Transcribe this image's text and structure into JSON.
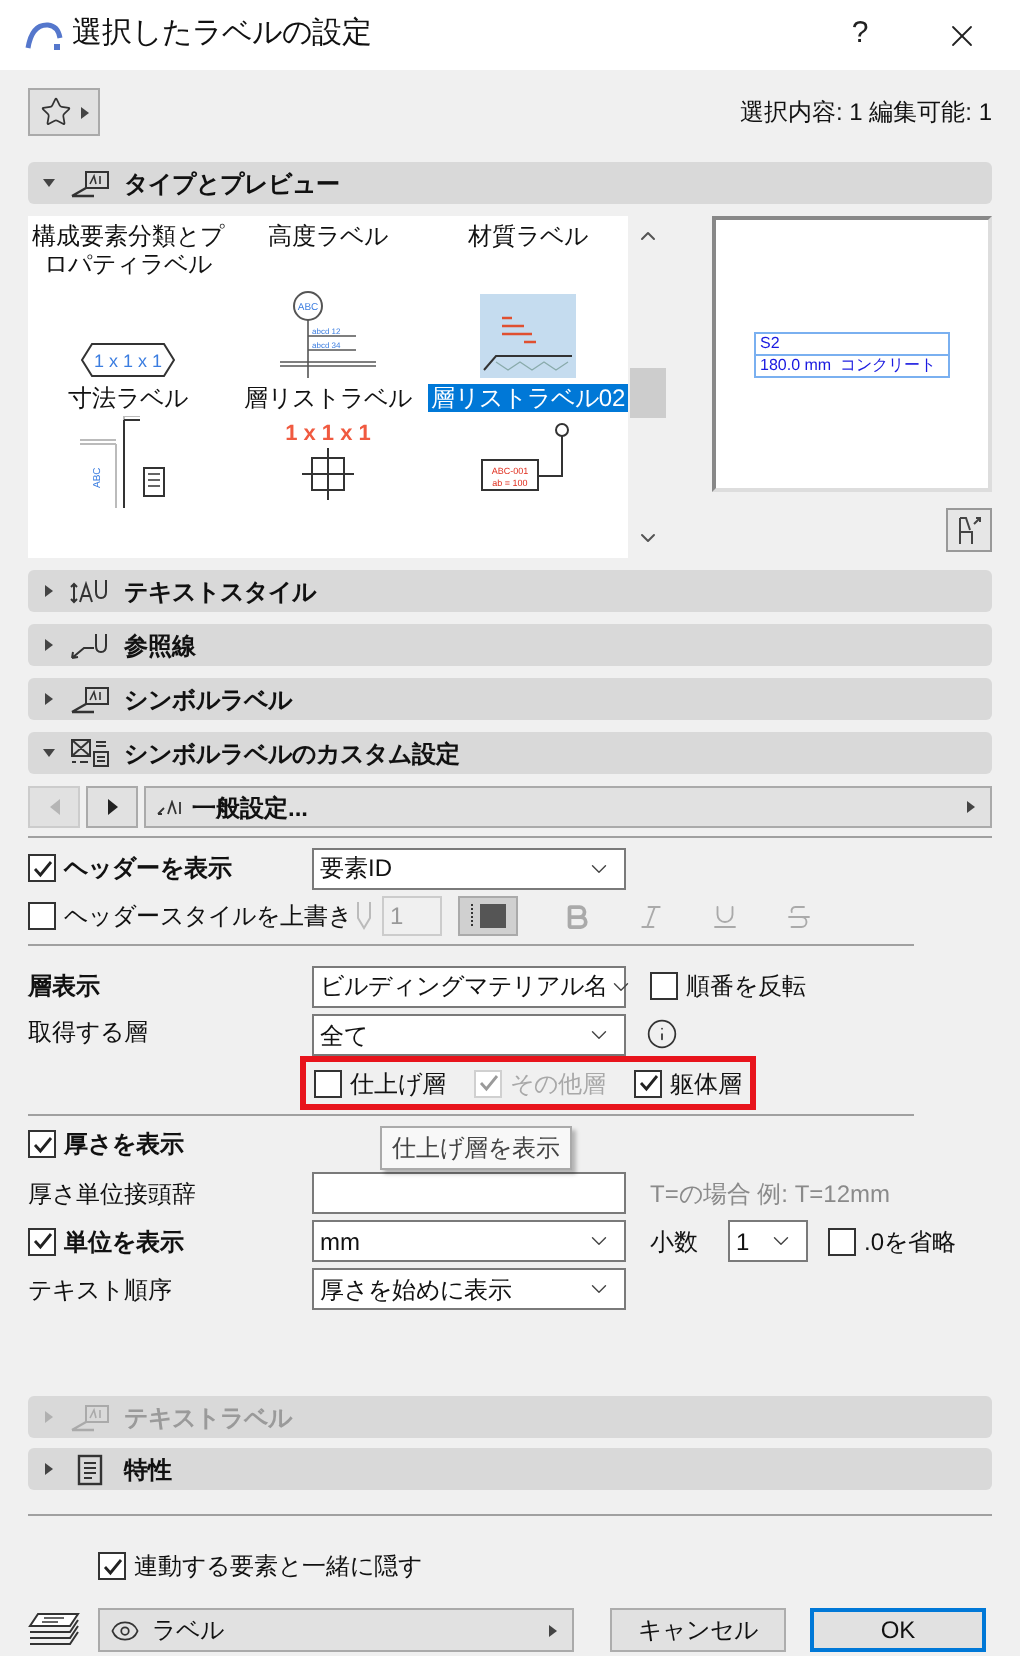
{
  "window": {
    "title": "選択したラベルの設定",
    "help_button": "?"
  },
  "selection_info": "選択内容: 1 編集可能: 1",
  "type_preview": {
    "title": "タイプとプレビュー",
    "expanded": true,
    "gallery": [
      {
        "label": "構成要素分類とプロパティラベル",
        "selected": false
      },
      {
        "label": "高度ラベル",
        "selected": false
      },
      {
        "label": "材質ラベル",
        "selected": false
      },
      {
        "label": "寸法ラベル",
        "selected": false,
        "kind": "hexagon",
        "texts": [
          "1 x 1 x 1"
        ]
      },
      {
        "label": "層リストラベル",
        "selected": false,
        "kind": "pole",
        "texts": [
          "ABC",
          "abcd  12",
          "abcd  34"
        ]
      },
      {
        "label": "層リストラベル02",
        "selected": true,
        "kind": "layers"
      },
      {
        "selected": false,
        "kind": "document",
        "texts": [
          "ABC"
        ]
      },
      {
        "selected": false,
        "kind": "cross",
        "texts": [
          "1 x 1 x 1"
        ]
      },
      {
        "selected": false,
        "kind": "tag",
        "texts": [
          "ABC-001",
          "ab = 100"
        ]
      }
    ],
    "preview": {
      "lines": [
        "S2",
        "180.0 mm  コンクリート"
      ]
    }
  },
  "sections": [
    {
      "title": "テキストスタイル",
      "expanded": false,
      "kind": "textstyle"
    },
    {
      "title": "参照線",
      "expanded": false,
      "kind": "leader"
    },
    {
      "title": "シンボルラベル",
      "expanded": false,
      "kind": "symbol"
    },
    {
      "title": "シンボルラベルのカスタム設定",
      "expanded": true,
      "kind": "custom"
    }
  ],
  "page_nav": {
    "prev_disabled": true,
    "page": "一般設定..."
  },
  "header": {
    "show": {
      "label": "ヘッダーを表示",
      "checked": true
    },
    "value": "要素ID",
    "override": {
      "label": "ヘッダースタイルを上書き",
      "checked": false
    },
    "pen": "1"
  },
  "layers": {
    "label": "層表示",
    "value": "ビルディングマテリアル名",
    "reverse": {
      "label": "順番を反転",
      "checked": false
    },
    "fetch_label": "取得する層",
    "fetch_value": "全て",
    "highlighted": true,
    "filters": [
      {
        "label": "仕上げ層",
        "checked": false,
        "disabled": false
      },
      {
        "label": "その他層",
        "checked": true,
        "disabled": true
      },
      {
        "label": "躯体層",
        "checked": true,
        "disabled": false
      }
    ]
  },
  "thickness": {
    "show": {
      "label": "厚さを表示",
      "checked": true
    },
    "tooltip": "仕上げ層を表示",
    "prefix_label": "厚さ単位接頭辞",
    "prefix_note": "T=の場合 例: T=12mm",
    "unit": {
      "label": "単位を表示",
      "checked": true
    },
    "unit_value": "mm",
    "decimals_label": "小数",
    "decimals_value": "1",
    "omit_zero": {
      "label": ".0を省略",
      "checked": false
    },
    "order_label": "テキスト順序",
    "order_value": "厚さを始めに表示"
  },
  "bottom_sections": [
    {
      "title": "テキストラベル",
      "expanded": false,
      "disabled": true,
      "kind": "symbol"
    },
    {
      "title": "特性",
      "expanded": false,
      "disabled": false,
      "kind": "properties"
    }
  ],
  "hide_with_linked": {
    "label": "連動する要素と一緒に隠す",
    "checked": true
  },
  "footer": {
    "layer": "ラベル",
    "cancel": "キャンセル",
    "ok": "OK"
  }
}
